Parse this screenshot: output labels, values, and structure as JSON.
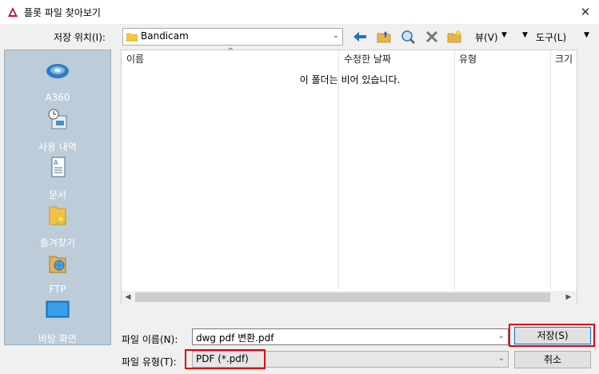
{
  "window": {
    "title": "플롯 파일 찾아보기",
    "close_glyph": "✕"
  },
  "location": {
    "label": "저장 위치(I):",
    "value": "Bandicam"
  },
  "toolbar": {
    "icons": [
      "back-arrow-icon",
      "up-folder-icon",
      "search-web-icon",
      "delete-icon",
      "new-folder-icon"
    ],
    "view_label": "뷰(V)",
    "tools_label": "도구(L)"
  },
  "places": [
    {
      "label": "A360",
      "icon": "cloud-icon"
    },
    {
      "label": "사용 내역",
      "icon": "history-icon"
    },
    {
      "label": "문서",
      "icon": "document-icon"
    },
    {
      "label": "즐겨찾기",
      "icon": "favorites-icon"
    },
    {
      "label": "FTP",
      "icon": "ftp-icon"
    },
    {
      "label": "바탕 화면",
      "icon": "desktop-icon"
    }
  ],
  "file_list": {
    "columns": [
      "이름",
      "수정한 날짜",
      "유형",
      "크기"
    ],
    "empty_message": "이 폴더는 비어 있습니다."
  },
  "file_name": {
    "label": "파일 이름(N):",
    "value": "dwg pdf 변환.pdf"
  },
  "file_type": {
    "label": "파일 유형(T):",
    "value": "PDF (*.pdf)"
  },
  "buttons": {
    "save": "저장(S)",
    "cancel": "취소"
  },
  "colors": {
    "accent_red": "#e0000a",
    "places_bg": "#bcccd9",
    "default_button_border": "#0078d7"
  }
}
